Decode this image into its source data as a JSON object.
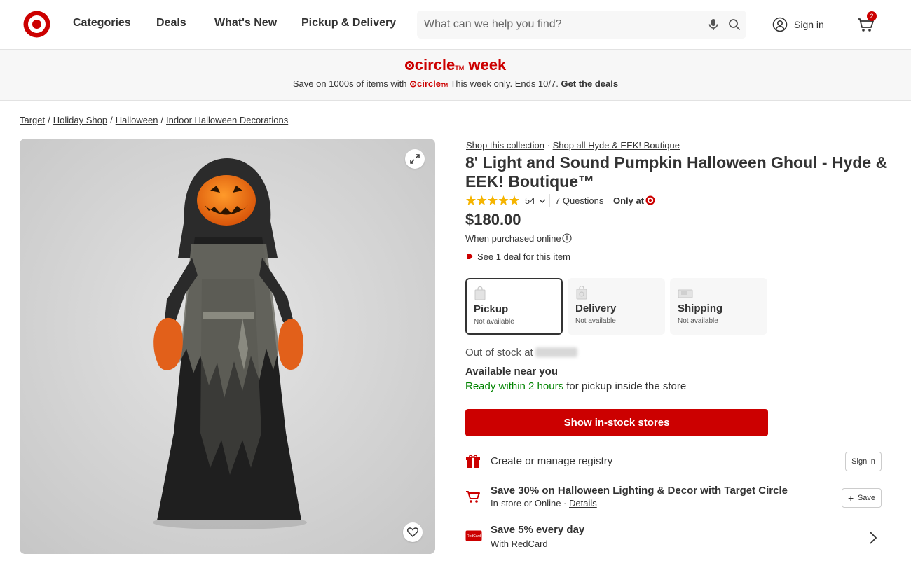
{
  "header": {
    "nav": [
      "Categories",
      "Deals",
      "What's New",
      "Pickup & Delivery"
    ],
    "search_placeholder": "What can we help you find?",
    "sign_in": "Sign in",
    "cart_count": "2",
    "brand_color": "#cc0000"
  },
  "promo": {
    "title_brand": "circle",
    "title_tm": "TM",
    "title_rest": " week",
    "sub_prefix": "Save on 1000s of items with ",
    "sub_brand": "circle",
    "sub_tm": "TM",
    "sub_suffix": " This week only. Ends 10/7. ",
    "sub_link": "Get the deals"
  },
  "breadcrumb": [
    "Target",
    "Holiday Shop",
    "Halloween",
    "Indoor Halloween Decorations"
  ],
  "breadcrumb_sep": "/",
  "product": {
    "shop_collection": "Shop this collection",
    "dot": " · ",
    "shop_brand": "Shop all Hyde & EEK! Boutique",
    "title": "8' Light and Sound Pumpkin Halloween Ghoul - Hyde & EEK! Boutique™",
    "rating_count": "54",
    "questions": "7 Questions",
    "only_at": "Only at",
    "price": "$180.00",
    "purchase_note": "When purchased online",
    "deal_link": "See 1 deal for this item"
  },
  "fulfillment": [
    {
      "title": "Pickup",
      "status": "Not available",
      "selected": true
    },
    {
      "title": "Delivery",
      "status": "Not available",
      "selected": false
    },
    {
      "title": "Shipping",
      "status": "Not available",
      "selected": false
    }
  ],
  "availability": {
    "out_of_stock": "Out of stock at",
    "near_you": "Available near you",
    "ready_green": "Ready within 2 hours",
    "ready_rest": " for pickup inside the store",
    "button": "Show in-stock stores"
  },
  "extras": {
    "registry_text": "Create or manage registry",
    "registry_button": "Sign in",
    "circle_offer": "Save 30% on Halloween Lighting & Decor with Target Circle",
    "circle_sub": "In-store or Online · ",
    "circle_details": "Details",
    "circle_button": "Save",
    "redcard_title": "Save 5% every day",
    "redcard_sub": "With RedCard",
    "redcard_label": "RedCard"
  }
}
